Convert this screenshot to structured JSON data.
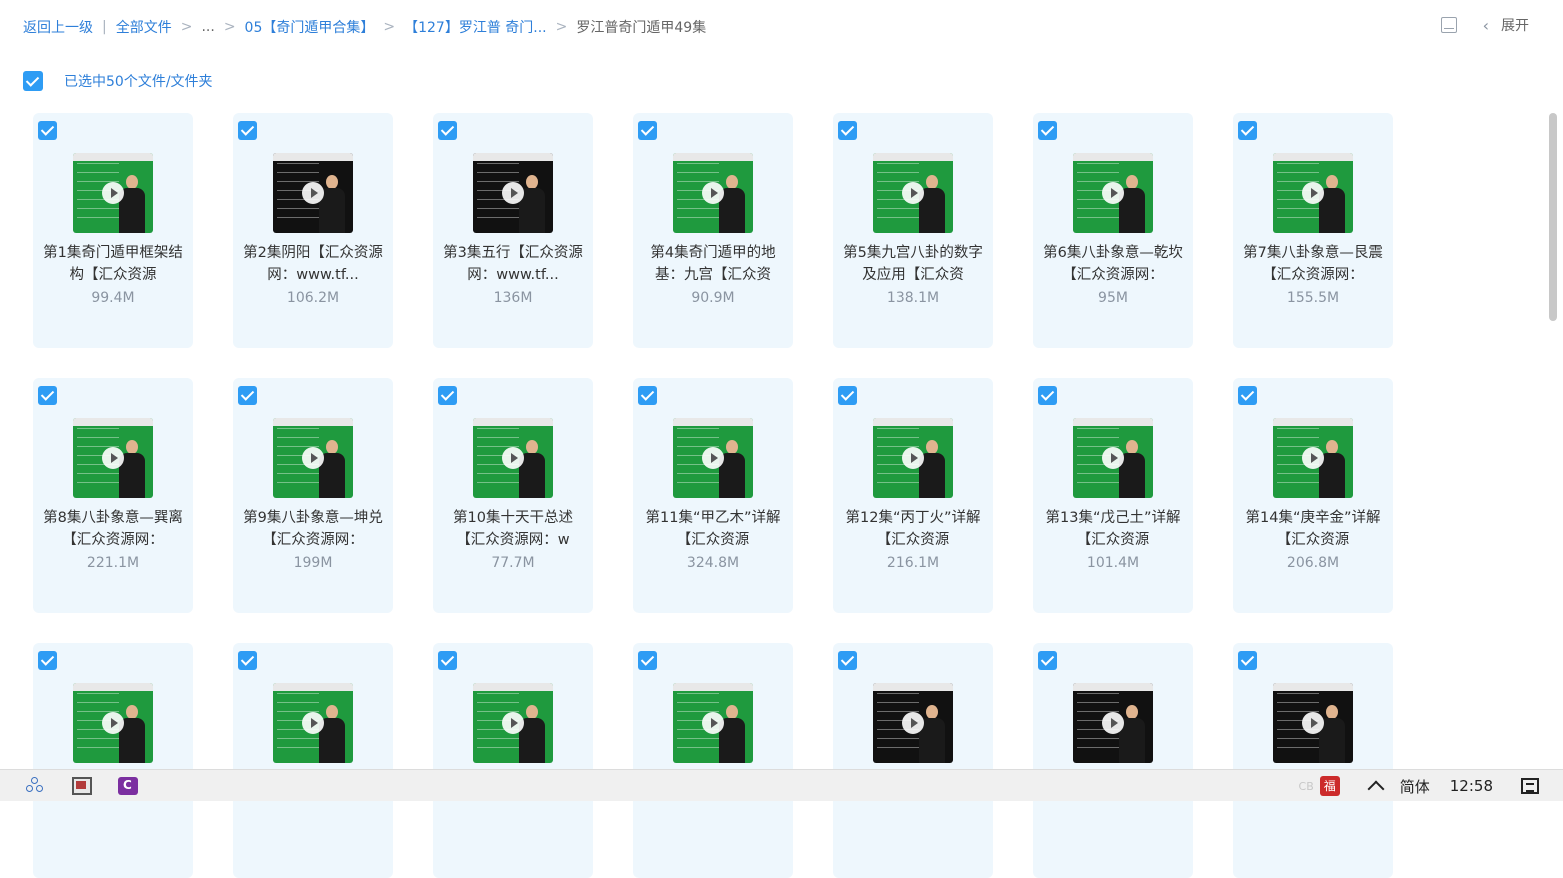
{
  "breadcrumb": {
    "back": "返回上一级",
    "items": [
      "全部文件",
      "...",
      "05【奇门遁甲合集】",
      "【127】罗江普 奇门...",
      "罗江普奇门遁甲49集"
    ]
  },
  "toolbar": {
    "expand": "展开"
  },
  "selection": {
    "text": "已选中50个文件/文件夹"
  },
  "files": [
    {
      "title": "第1集奇门遁甲框架结构【汇众资源",
      "size": "99.4M"
    },
    {
      "title": "第2集阴阳【汇众资源网：www.tf...",
      "size": "106.2M"
    },
    {
      "title": "第3集五行【汇众资源网：www.tf...",
      "size": "136M"
    },
    {
      "title": "第4集奇门遁甲的地基：九宫【汇众资",
      "size": "90.9M"
    },
    {
      "title": "第5集九宫八卦的数字及应用【汇众资",
      "size": "138.1M"
    },
    {
      "title": "第6集八卦象意—乾坎【汇众资源网：",
      "size": "95M"
    },
    {
      "title": "第7集八卦象意—艮震【汇众资源网：",
      "size": "155.5M"
    },
    {
      "title": "第8集八卦象意—巽离【汇众资源网：",
      "size": "221.1M"
    },
    {
      "title": "第9集八卦象意—坤兑【汇众资源网：",
      "size": "199M"
    },
    {
      "title": "第10集十天干总述【汇众资源网：w",
      "size": "77.7M"
    },
    {
      "title": "第11集“甲乙木”详解【汇众资源",
      "size": "324.8M"
    },
    {
      "title": "第12集“丙丁火”详解【汇众资源",
      "size": "216.1M"
    },
    {
      "title": "第13集“戊己土”详解【汇众资源",
      "size": "101.4M"
    },
    {
      "title": "第14集“庚辛金”详解【汇众资源",
      "size": "206.8M"
    },
    {
      "title": "",
      "size": ""
    },
    {
      "title": "",
      "size": ""
    },
    {
      "title": "",
      "size": ""
    },
    {
      "title": "",
      "size": ""
    },
    {
      "title": "",
      "size": ""
    },
    {
      "title": "",
      "size": ""
    },
    {
      "title": "",
      "size": ""
    }
  ],
  "taskbar": {
    "ime": "简体",
    "clock": "12:58",
    "tray_small": "CB",
    "stamp": "福"
  }
}
